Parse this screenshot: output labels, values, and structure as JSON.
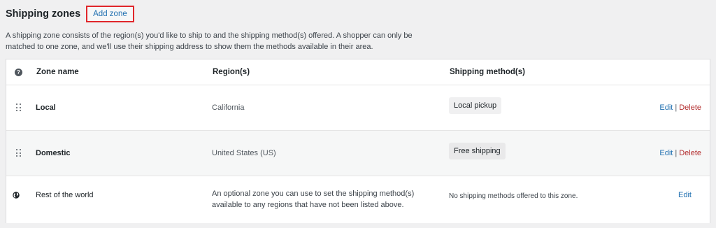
{
  "header": {
    "title": "Shipping zones",
    "add_zone_label": "Add zone"
  },
  "description": "A shipping zone consists of the region(s) you'd like to ship to and the shipping method(s) offered. A shopper can only be matched to one zone, and we'll use their shipping address to show them the methods available in their area.",
  "table": {
    "columns": [
      "Zone name",
      "Region(s)",
      "Shipping method(s)"
    ],
    "help_icon_glyph": "?",
    "rows": [
      {
        "zone": "Local",
        "region": "California",
        "method": "Local pickup",
        "edit": "Edit",
        "sep": "|",
        "delete": "Delete"
      },
      {
        "zone": "Domestic",
        "region": "United States (US)",
        "method": "Free shipping",
        "edit": "Edit",
        "sep": "|",
        "delete": "Delete"
      }
    ],
    "rest": {
      "zone": "Rest of the world",
      "region": "An optional zone you can use to set the shipping method(s) available to any regions that have not been listed above.",
      "method": "No shipping methods offered to this zone.",
      "edit": "Edit"
    }
  },
  "colors": {
    "link": "#2271b1",
    "delete": "#b32d2e",
    "highlight_border": "#e0262b"
  }
}
